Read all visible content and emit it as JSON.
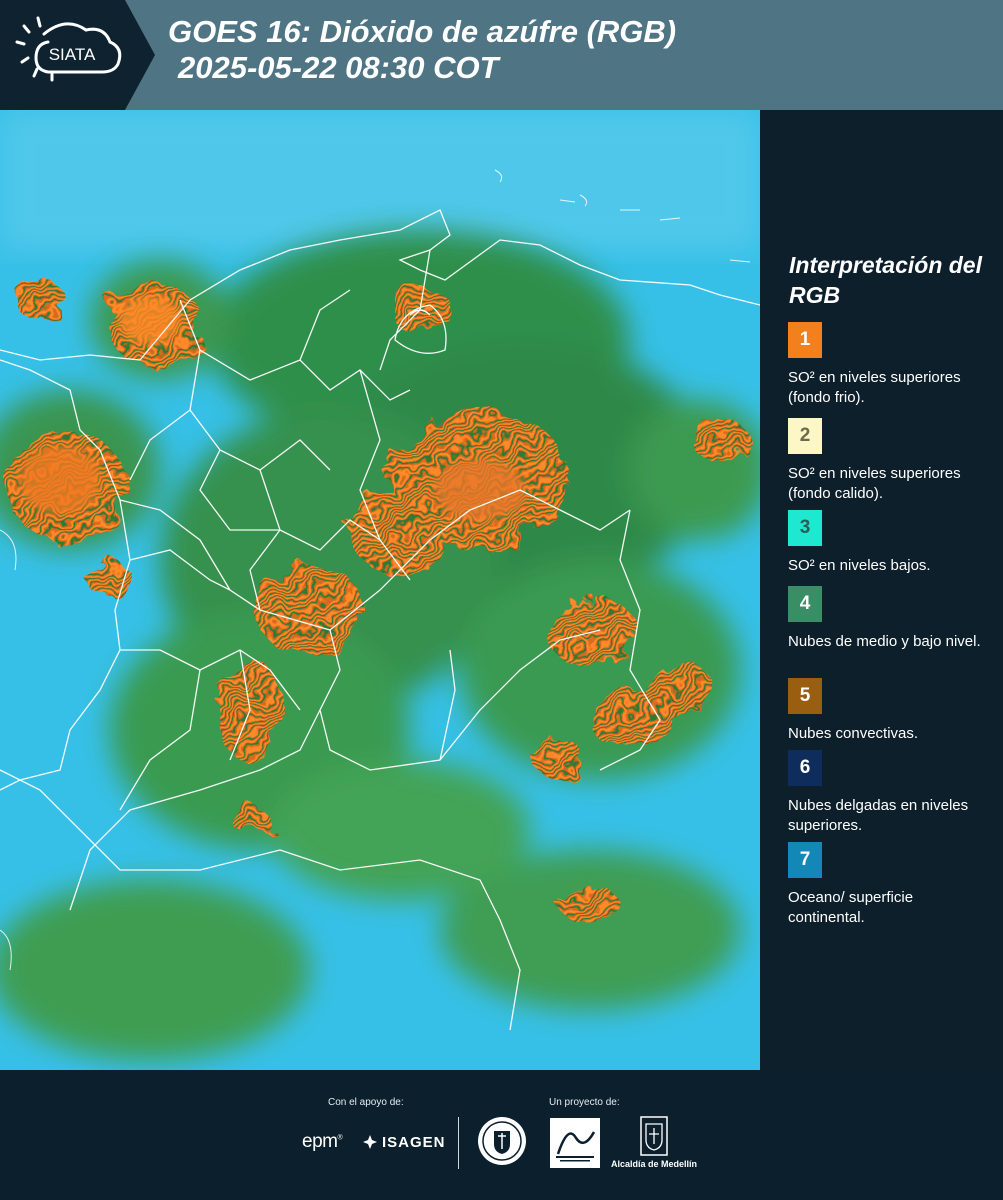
{
  "header": {
    "logo_text": "SIATA",
    "title_line1": "GOES 16: Dióxido de azúfre (RGB)",
    "title_line2": "2025-05-22 08:30 COT"
  },
  "legend": {
    "title": "Interpretación del RGB",
    "items": [
      {
        "number": "1",
        "color": "#f2801c",
        "text": "SO² en niveles superiores (fondo frio)."
      },
      {
        "number": "2",
        "color": "#fdf7c7",
        "text": "SO² en niveles superiores (fondo calido)."
      },
      {
        "number": "3",
        "color": "#1ee8cf",
        "text": "SO² en niveles bajos."
      },
      {
        "number": "4",
        "color": "#3a8e65",
        "text": "Nubes de medio y bajo nivel."
      },
      {
        "number": "5",
        "color": "#9a5e10",
        "text": "Nubes convectivas."
      },
      {
        "number": "6",
        "color": "#0e2c5c",
        "text": "Nubes delgadas en niveles superiores."
      },
      {
        "number": "7",
        "color": "#1388b6",
        "text": "Oceano/ superficie continental."
      }
    ]
  },
  "footer": {
    "support_label": "Con el apoyo de:",
    "project_label": "Un proyecto de:",
    "epm": "epm",
    "isagen": "ISAGEN",
    "alcaldia": "Alcaldía de Medellín"
  }
}
